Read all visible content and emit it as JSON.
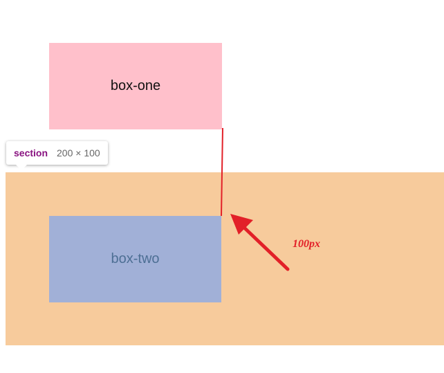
{
  "boxes": {
    "box_one": "box-one",
    "box_two": "box-two"
  },
  "tooltip": {
    "tag": "section",
    "size": "200 × 100"
  },
  "annotation": {
    "label": "100px"
  },
  "colors": {
    "box_one_bg": "#ffc0cb",
    "section_bg": "#f7cb9c",
    "box_two_bg": "#a1b0d7",
    "box_two_text": "#4d6f94",
    "annotation": "#e22028",
    "tooltip_tag": "#881280"
  }
}
